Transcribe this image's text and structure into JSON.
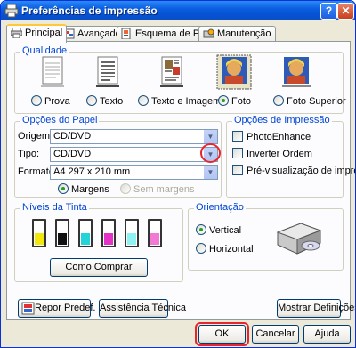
{
  "window": {
    "title": "Preferências de impressão",
    "help_button": "?",
    "close_button": "✕"
  },
  "tabs": [
    {
      "label": "Principal",
      "mnemonic_index": 0
    },
    {
      "label": "Avançado"
    },
    {
      "label": "Esquema de Página"
    },
    {
      "label": "Manutenção"
    }
  ],
  "quality": {
    "label": "Qualidade",
    "options": [
      {
        "label": "Prova",
        "selected": false
      },
      {
        "label": "Texto",
        "selected": false
      },
      {
        "label": "Texto e Imagem",
        "selected": false
      },
      {
        "label": "Foto",
        "selected": true
      },
      {
        "label": "Foto Superior",
        "selected": false
      }
    ]
  },
  "paper_options": {
    "label": "Opções do Papel",
    "origem_label": "Origem:",
    "origem_value": "CD/DVD",
    "tipo_label": "Tipo:",
    "tipo_value": "CD/DVD",
    "formato_label": "Formato:",
    "formato_value": "A4 297 x 210 mm",
    "margens_label": "Margens",
    "sem_margens_label": "Sem margens"
  },
  "print_options": {
    "label": "Opções de Impressão",
    "photo_enhance": "PhotoEnhance",
    "inverter_ordem": "Inverter Ordem",
    "pre_visualizacao": "Pré-visualização de impressão"
  },
  "ink_levels": {
    "label": "Níveis da Tinta",
    "cartridges": [
      {
        "color": "#f5e60a",
        "level": 0.5
      },
      {
        "color": "#111111",
        "level": 0.5
      },
      {
        "color": "#22d4d8",
        "level": 0.5
      },
      {
        "color": "#e531c6",
        "level": 0.5
      },
      {
        "color": "#8ef2f2",
        "level": 0.5
      },
      {
        "color": "#f37ad4",
        "level": 0.5
      }
    ],
    "buy_button": "Como Comprar"
  },
  "orientation": {
    "label": "Orientação",
    "vertical": "Vertical",
    "horizontal": "Horizontal"
  },
  "footer_buttons": {
    "repor": "Repor Predef.",
    "assistencia": "Assistência Técnica",
    "mostrar": "Mostrar Definições"
  },
  "dialog_buttons": {
    "ok": "OK",
    "cancel": "Cancelar",
    "help": "Ajuda"
  },
  "colors": {
    "titlebar": "#0552d3",
    "group_label": "#0046d5",
    "highlight": "#e8242c",
    "dialog_bg": "#ece9d8"
  }
}
